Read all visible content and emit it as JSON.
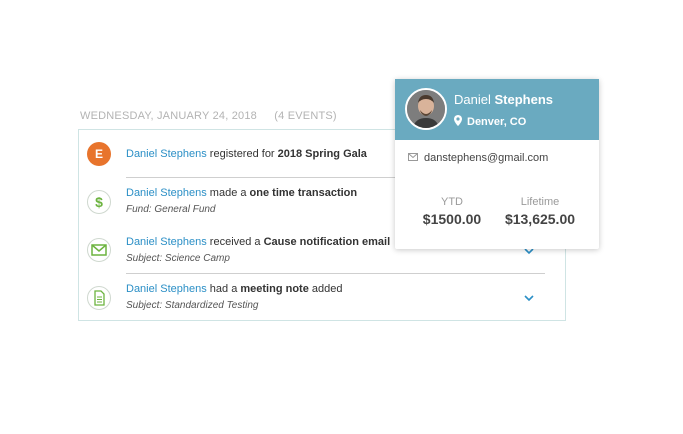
{
  "date_header": {
    "date": "WEDNESDAY, JANUARY 24, 2018",
    "count": "(4 EVENTS)"
  },
  "events": [
    {
      "name": "Daniel Stephens",
      "verb": " registered for ",
      "object": "2018 Spring Gala",
      "suffix": "",
      "detail": "",
      "icon": "eventbrite-icon",
      "icon_color": "#e8742c"
    },
    {
      "name": "Daniel Stephens",
      "verb": " made a ",
      "object": "one time transaction",
      "suffix": "",
      "detail": "Fund: General Fund",
      "icon": "dollar-icon",
      "icon_color": "#6cb33f"
    },
    {
      "name": "Daniel Stephens",
      "verb": " received a ",
      "object": "Cause notification email",
      "suffix": "",
      "detail": "Subject: Science Camp",
      "icon": "envelope-icon",
      "icon_color": "#6cb33f"
    },
    {
      "name": "Daniel Stephens",
      "verb": " had a ",
      "object": "meeting note",
      "suffix": " added",
      "detail": "Subject: Standardized Testing",
      "icon": "document-icon",
      "icon_color": "#6cb33f"
    }
  ],
  "profile_card": {
    "first_name": "Daniel",
    "last_name": "Stephens",
    "location": "Denver, CO",
    "email": "danstephens@gmail.com",
    "stats": [
      {
        "label": "YTD",
        "value": "$1500.00"
      },
      {
        "label": "Lifetime",
        "value": "$13,625.00"
      }
    ],
    "header_color": "#6aaac0"
  }
}
